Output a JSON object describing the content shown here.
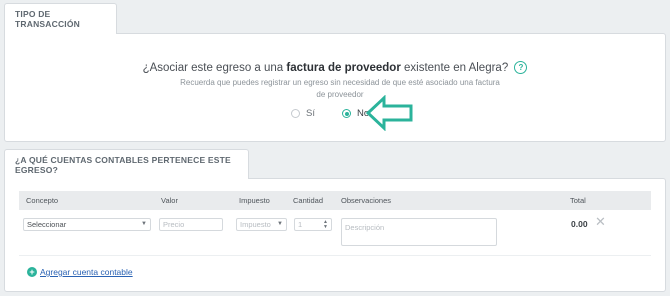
{
  "tipo_tab": {
    "label": "Tipo de transacción"
  },
  "question": {
    "prefix": "¿Asociar este egreso a una ",
    "bold": "factura de proveedor",
    "suffix": " existente en Alegra?",
    "help_icon": "?",
    "subtext": "Recuerda que puedes registrar un egreso sin necesidad de que esté asociado una factura de proveedor"
  },
  "radios": {
    "si_label": "Sí",
    "no_label": "No",
    "selected": "No"
  },
  "cuentas_tab": {
    "label": "¿A qué cuentas contables pertenece este egreso?"
  },
  "table": {
    "headers": {
      "concepto": "Concepto",
      "valor": "Valor",
      "impuesto": "Impuesto",
      "cantidad": "Cantidad",
      "observaciones": "Observaciones",
      "total": "Total"
    },
    "row": {
      "concepto_value": "Seleccionar",
      "valor_placeholder": "Precio",
      "impuesto_placeholder": "Impuesto",
      "cantidad_value": "1",
      "observaciones_placeholder": "Descripción",
      "total": "0.00"
    }
  },
  "add_link": {
    "label": "Agregar cuenta contable",
    "icon": "plus-circle-icon"
  },
  "colors": {
    "accent": "#2bb39b",
    "link": "#2a62b3"
  }
}
